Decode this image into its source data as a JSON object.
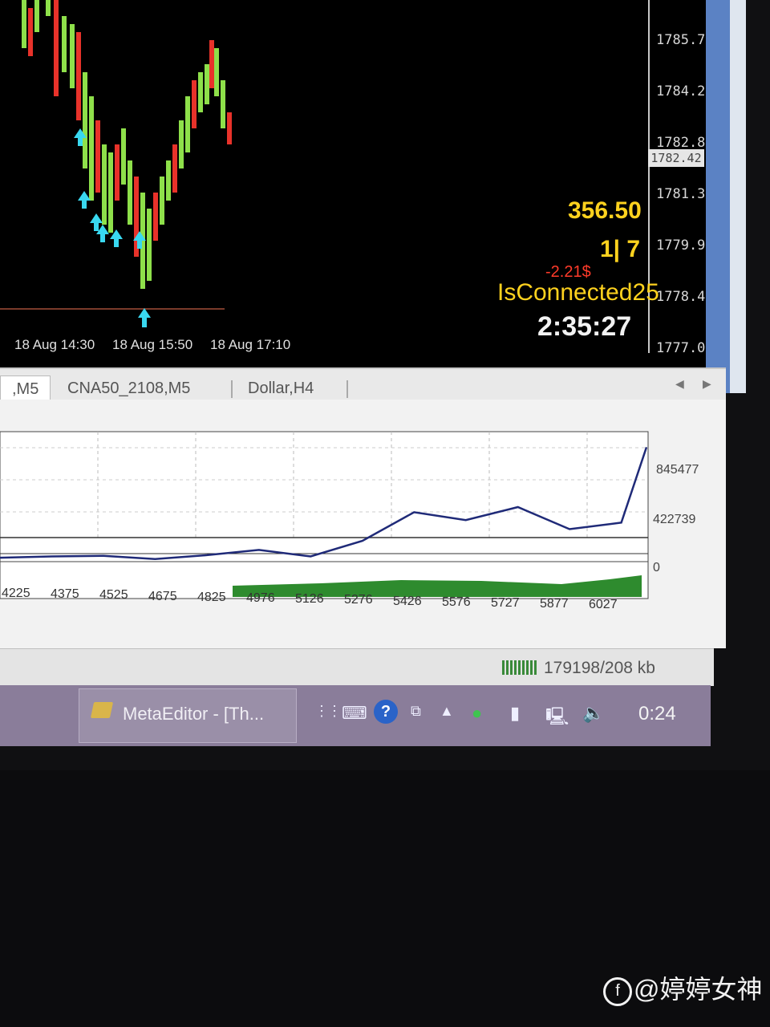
{
  "chart": {
    "price_labels": [
      "1785.70",
      "1784.25",
      "1782.80",
      "1781.35",
      "1779.90",
      "1778.45",
      "1777.00"
    ],
    "current_price": "1782.42",
    "time_labels": [
      "18 Aug 14:30",
      "18 Aug 15:50",
      "18 Aug 17:10"
    ],
    "overlay": {
      "profit": "356.50",
      "ratio": "1| 7",
      "pnl_small": "-2.21$",
      "connection": "IsConnected",
      "connection_suffix": "25",
      "countdown": "2:35:27"
    }
  },
  "tabs": [
    {
      "label": ",M5",
      "active": true
    },
    {
      "label": "CNA50_2108,M5",
      "active": false
    },
    {
      "label": "Dollar,H4",
      "active": false
    }
  ],
  "tester_graph": {
    "y_labels": [
      "845477",
      "422739",
      "0"
    ],
    "x_labels": [
      "4225",
      "4375",
      "4525",
      "4675",
      "4825",
      "4976",
      "5126",
      "5276",
      "5426",
      "5576",
      "5727",
      "5877",
      "6027"
    ]
  },
  "status": {
    "traffic": "179198/208 kb"
  },
  "taskbar": {
    "task_label": "MetaEditor - [Th...",
    "clock": "0:24"
  },
  "watermark": "@婷婷女神",
  "chart_data": {
    "type": "line",
    "x": [
      4225,
      4375,
      4525,
      4675,
      4825,
      4976,
      5126,
      5276,
      5426,
      5576,
      5727,
      5877,
      6027,
      6100
    ],
    "series": [
      {
        "values": [
          30000,
          40000,
          45000,
          20000,
          50000,
          90000,
          40000,
          160000,
          380000,
          320000,
          420000,
          250000,
          300000,
          880000
        ]
      }
    ],
    "ylim": [
      0,
      1000000
    ],
    "color": "#1f2a78"
  }
}
